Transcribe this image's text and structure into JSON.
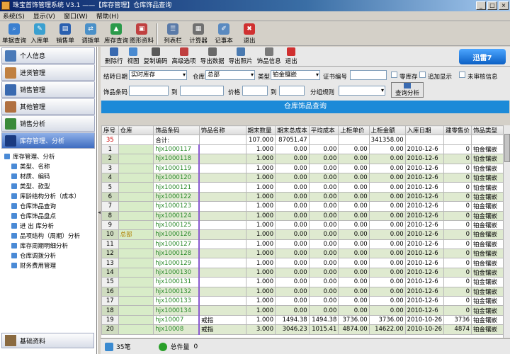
{
  "window": {
    "title": "珠宝首饰管理系统 V3.1 ——【库存管理】仓库饰品查询"
  },
  "menu": [
    "系统(S)",
    "显示(V)",
    "窗口(W)",
    "帮助(H)"
  ],
  "main_toolbar": [
    "单据查询",
    "入库单",
    "销售单",
    "调拨单",
    "库存查询",
    "图形资料",
    "列表栏",
    "计算器",
    "记事本",
    "退出"
  ],
  "sidebar": {
    "categories": [
      "个人信息",
      "进货管理",
      "销售管理",
      "其他管理",
      "销售分析",
      "库存管理、分析"
    ],
    "tree_root": "库存管理、分析",
    "tree_items": [
      "类型、名称",
      "材质、编码",
      "类型、款型",
      "库龄结构分析（成本）",
      "仓库饰品查询",
      "仓库饰品盘点",
      "进 出 库分析",
      "品项结构（周期）分析",
      "库存周期明细分析",
      "仓库调拨分析",
      "财务费用管理"
    ],
    "bottom": "基础资料"
  },
  "sub_toolbar": [
    "删除行",
    "视图",
    "复制编码",
    "高级选项",
    "导出数据",
    "导出照片",
    "饰品信息",
    "退出"
  ],
  "logo": "迅雷7",
  "filters": {
    "date_label": "结转日期",
    "date_value": "实时库存",
    "warehouse_label": "仓库",
    "warehouse_value": "总部",
    "type_label": "类型",
    "type_value": "铂金镶嵌",
    "cert_label": "证书编号",
    "chk1": "零库存",
    "chk2": "追加显示",
    "chk3": "未审核信息",
    "code_label": "饰品条码",
    "to1": "到",
    "price_label": "价格",
    "to2": "到",
    "group_label": "分组规则",
    "query_btn": "查询分析"
  },
  "grid_title": "仓库饰品查询",
  "columns": [
    "序号",
    "仓库",
    "饰品条码",
    "饰品名称",
    "期末数量",
    "期末总成本",
    "平均成本",
    "上柜单价",
    "上柜金额",
    "入库日期",
    "建零售价",
    "饰品类型"
  ],
  "sum_row": {
    "seq": "35",
    "label": "合计:",
    "qty": "107.000",
    "cost": "87051.47",
    "amount": "341358.00"
  },
  "warehouse_merged": "总部",
  "rows": [
    {
      "seq": "1",
      "code": "hjx1000117",
      "name": "",
      "qty": "1.000",
      "cost": "0.00",
      "avg": "0.00",
      "price": "0.00",
      "amount": "0.00",
      "date": "2010-12-6",
      "retail": "0",
      "type": "铂金镶嵌"
    },
    {
      "seq": "2",
      "code": "hjx1000118",
      "name": "",
      "qty": "1.000",
      "cost": "0.00",
      "avg": "0.00",
      "price": "0.00",
      "amount": "0.00",
      "date": "2010-12-6",
      "retail": "0",
      "type": "铂金镶嵌"
    },
    {
      "seq": "3",
      "code": "hjx1000119",
      "name": "",
      "qty": "1.000",
      "cost": "0.00",
      "avg": "0.00",
      "price": "0.00",
      "amount": "0.00",
      "date": "2010-12-6",
      "retail": "0",
      "type": "铂金镶嵌"
    },
    {
      "seq": "4",
      "code": "hjx1000120",
      "name": "",
      "qty": "1.000",
      "cost": "0.00",
      "avg": "0.00",
      "price": "0.00",
      "amount": "0.00",
      "date": "2010-12-6",
      "retail": "0",
      "type": "铂金镶嵌"
    },
    {
      "seq": "5",
      "code": "hjx1000121",
      "name": "",
      "qty": "1.000",
      "cost": "0.00",
      "avg": "0.00",
      "price": "0.00",
      "amount": "0.00",
      "date": "2010-12-6",
      "retail": "0",
      "type": "铂金镶嵌"
    },
    {
      "seq": "6",
      "code": "hjx1000122",
      "name": "",
      "qty": "1.000",
      "cost": "0.00",
      "avg": "0.00",
      "price": "0.00",
      "amount": "0.00",
      "date": "2010-12-6",
      "retail": "0",
      "type": "铂金镶嵌"
    },
    {
      "seq": "7",
      "code": "hjx1000123",
      "name": "",
      "qty": "1.000",
      "cost": "0.00",
      "avg": "0.00",
      "price": "0.00",
      "amount": "0.00",
      "date": "2010-12-6",
      "retail": "0",
      "type": "铂金镶嵌"
    },
    {
      "seq": "8",
      "code": "hjx1000124",
      "name": "",
      "qty": "1.000",
      "cost": "0.00",
      "avg": "0.00",
      "price": "0.00",
      "amount": "0.00",
      "date": "2010-12-6",
      "retail": "0",
      "type": "铂金镶嵌"
    },
    {
      "seq": "9",
      "code": "hjx1000125",
      "name": "",
      "qty": "1.000",
      "cost": "0.00",
      "avg": "0.00",
      "price": "0.00",
      "amount": "0.00",
      "date": "2010-12-6",
      "retail": "0",
      "type": "铂金镶嵌"
    },
    {
      "seq": "10",
      "code": "hjx1000126",
      "name": "",
      "qty": "1.000",
      "cost": "0.00",
      "avg": "0.00",
      "price": "0.00",
      "amount": "0.00",
      "date": "2010-12-6",
      "retail": "0",
      "type": "铂金镶嵌"
    },
    {
      "seq": "11",
      "code": "hjx1000127",
      "name": "",
      "qty": "1.000",
      "cost": "0.00",
      "avg": "0.00",
      "price": "0.00",
      "amount": "0.00",
      "date": "2010-12-6",
      "retail": "0",
      "type": "铂金镶嵌"
    },
    {
      "seq": "12",
      "code": "hjx1000128",
      "name": "",
      "qty": "1.000",
      "cost": "0.00",
      "avg": "0.00",
      "price": "0.00",
      "amount": "0.00",
      "date": "2010-12-6",
      "retail": "0",
      "type": "铂金镶嵌"
    },
    {
      "seq": "13",
      "code": "hjx1000129",
      "name": "",
      "qty": "1.000",
      "cost": "0.00",
      "avg": "0.00",
      "price": "0.00",
      "amount": "0.00",
      "date": "2010-12-6",
      "retail": "0",
      "type": "铂金镶嵌"
    },
    {
      "seq": "14",
      "code": "hjx1000130",
      "name": "",
      "qty": "1.000",
      "cost": "0.00",
      "avg": "0.00",
      "price": "0.00",
      "amount": "0.00",
      "date": "2010-12-6",
      "retail": "0",
      "type": "铂金镶嵌"
    },
    {
      "seq": "15",
      "code": "hjx1000131",
      "name": "",
      "qty": "1.000",
      "cost": "0.00",
      "avg": "0.00",
      "price": "0.00",
      "amount": "0.00",
      "date": "2010-12-6",
      "retail": "0",
      "type": "铂金镶嵌"
    },
    {
      "seq": "16",
      "code": "hjx1000132",
      "name": "",
      "qty": "1.000",
      "cost": "0.00",
      "avg": "0.00",
      "price": "0.00",
      "amount": "0.00",
      "date": "2010-12-6",
      "retail": "0",
      "type": "铂金镶嵌"
    },
    {
      "seq": "17",
      "code": "hjx1000133",
      "name": "",
      "qty": "1.000",
      "cost": "0.00",
      "avg": "0.00",
      "price": "0.00",
      "amount": "0.00",
      "date": "2010-12-6",
      "retail": "0",
      "type": "铂金镶嵌"
    },
    {
      "seq": "18",
      "code": "hjx1000134",
      "name": "",
      "qty": "1.000",
      "cost": "0.00",
      "avg": "0.00",
      "price": "0.00",
      "amount": "0.00",
      "date": "2010-12-6",
      "retail": "0",
      "type": "铂金镶嵌"
    },
    {
      "seq": "19",
      "code": "hjx10007",
      "name": "戒指",
      "qty": "1.000",
      "cost": "1494.38",
      "avg": "1494.38",
      "price": "3736.00",
      "amount": "3736.00",
      "date": "2010-10-26",
      "retail": "3736",
      "type": "铂金镶嵌"
    },
    {
      "seq": "20",
      "code": "hjx10008",
      "name": "戒指",
      "qty": "3.000",
      "cost": "3046.23",
      "avg": "1015.41",
      "price": "4874.00",
      "amount": "14622.00",
      "date": "2010-10-26",
      "retail": "4874",
      "type": "铂金镶嵌"
    }
  ],
  "status": {
    "count": "35笔",
    "total_label": "总件量",
    "total_value": "0"
  }
}
